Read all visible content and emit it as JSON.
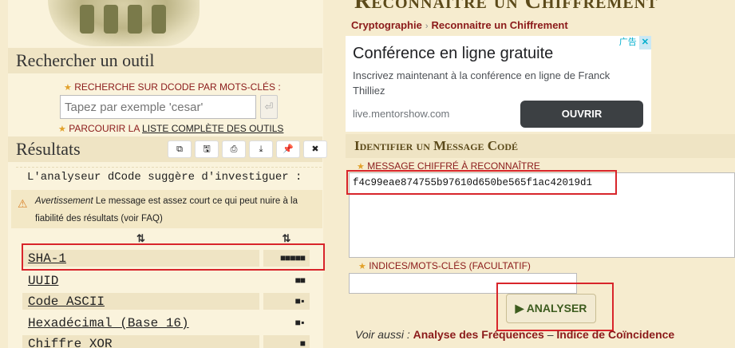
{
  "left": {
    "search_header": "Rechercher un outil",
    "search_label": "RECHERCHE SUR DCODE PAR MOTS-CLÉS :",
    "search_placeholder": "Tapez par exemple 'cesar'",
    "search_button_glyph": "⏎",
    "browse_prefix": "PARCOURIR LA ",
    "browse_link": "LISTE COMPLÈTE DES OUTILS",
    "results_header": "Résultats",
    "toolbar": [
      "copy-icon",
      "save-icon",
      "print-icon",
      "download-icon",
      "pin-icon",
      "close-icon"
    ],
    "toolbar_glyphs": [
      "⧉",
      "🖫",
      "⎙",
      "⤓",
      "📌",
      "✖"
    ],
    "analyser_message": "L'analyseur dCode suggère d'investiguer :",
    "warning_label": "Avertissement",
    "warning_text": " Le message est assez court ce qui peut nuire à la fiabilité des résultats (voir FAQ)",
    "sort_glyph": "⇅",
    "results": [
      {
        "name": "SHA-1",
        "score": "■■■■■"
      },
      {
        "name": "UUID",
        "score": "■■"
      },
      {
        "name": "Code ASCII",
        "score": "■▪"
      },
      {
        "name": "Hexadécimal (Base 16)",
        "score": "■▪"
      },
      {
        "name": "Chiffre XOR",
        "score": "■"
      }
    ]
  },
  "right": {
    "title": "Reconnaître un Chiffrement",
    "breadcrumb": [
      "Cryptographie",
      "Reconnaitre un Chiffrement"
    ],
    "breadcrumb_sep": "›",
    "ad": {
      "title": "Conférence en ligne gratuite",
      "desc": "Inscrivez maintenant à la conférence en ligne de Franck Thilliez",
      "url": "live.mentorshow.com",
      "button": "OUVRIR",
      "badge": "广告",
      "close": "✕"
    },
    "form_header": "Identifier un Message Codé",
    "message_label": "MESSAGE CHIFFRÉ À RECONNAÎTRE",
    "message_value": "f4c99eae874755b97610d650be565f1ac42019d1",
    "hint_label": "INDICES/MOTS-CLÉS (FACULTATIF)",
    "hint_value": "",
    "analyse_button": "▶ ANALYSER",
    "see_also_label": "Voir aussi :",
    "see_also_links": [
      "Analyse des Fréquences",
      "Indice de Coïncidence"
    ],
    "see_also_sep": " – "
  },
  "colors": {
    "accent_red": "#8b1a1a",
    "highlight_box": "#d8252b",
    "panel": "#efe4c4"
  }
}
